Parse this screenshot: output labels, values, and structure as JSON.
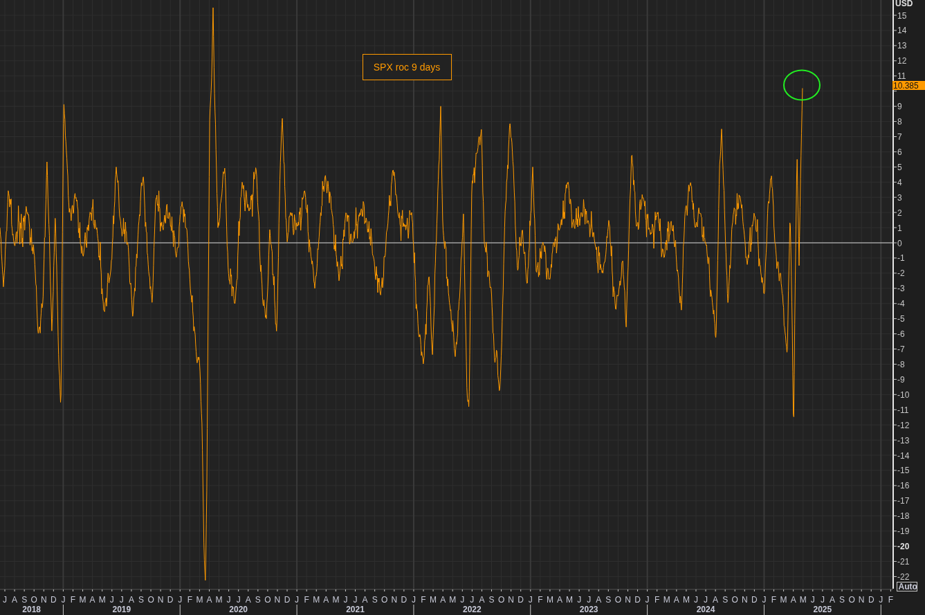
{
  "chart": {
    "legend": "SPX roc 9 days",
    "currency": "USD",
    "last_value": "10.385",
    "auto_button": "Auto",
    "y_labels_upper": [
      {
        "label": "15",
        "bold": false
      },
      {
        "label": "14",
        "bold": false
      },
      {
        "label": "13",
        "bold": false
      },
      {
        "label": "12",
        "bold": false
      },
      {
        "label": "11",
        "bold": false
      }
    ],
    "y_labels_lower": [
      {
        "label": "9",
        "bold": false
      },
      {
        "label": "8",
        "bold": false
      },
      {
        "label": "7",
        "bold": false
      },
      {
        "label": "6",
        "bold": false
      },
      {
        "label": "5",
        "bold": false
      },
      {
        "label": "4",
        "bold": false
      },
      {
        "label": "3",
        "bold": false
      },
      {
        "label": "2",
        "bold": false
      },
      {
        "label": "1",
        "bold": false
      },
      {
        "label": "0",
        "bold": false
      },
      {
        "label": "-1",
        "bold": false
      },
      {
        "label": "-2",
        "bold": false
      },
      {
        "label": "-3",
        "bold": false
      },
      {
        "label": "-4",
        "bold": false
      },
      {
        "label": "-5",
        "bold": false
      },
      {
        "label": "-6",
        "bold": false
      },
      {
        "label": "-7",
        "bold": false
      },
      {
        "label": "-8",
        "bold": false
      },
      {
        "label": "-9",
        "bold": false
      },
      {
        "label": "-10",
        "bold": false
      },
      {
        "label": "-11",
        "bold": false
      },
      {
        "label": "-12",
        "bold": false
      },
      {
        "label": "-13",
        "bold": false
      },
      {
        "label": "-14",
        "bold": false
      },
      {
        "label": "-15",
        "bold": false
      },
      {
        "label": "-16",
        "bold": false
      },
      {
        "label": "-17",
        "bold": false
      },
      {
        "label": "-18",
        "bold": false
      },
      {
        "label": "-19",
        "bold": false
      },
      {
        "label": "-20",
        "bold": true
      },
      {
        "label": "-21",
        "bold": false
      },
      {
        "label": "-22",
        "bold": false
      }
    ],
    "years": [
      {
        "label": "2018",
        "months": [
          "J",
          "A",
          "S",
          "O",
          "N",
          "D"
        ]
      },
      {
        "label": "2019",
        "months": [
          "J",
          "F",
          "M",
          "A",
          "M",
          "J",
          "J",
          "A",
          "S",
          "O",
          "N",
          "D"
        ]
      },
      {
        "label": "2020",
        "months": [
          "J",
          "F",
          "M",
          "A",
          "M",
          "J",
          "J",
          "A",
          "S",
          "O",
          "N",
          "D"
        ]
      },
      {
        "label": "2021",
        "months": [
          "J",
          "F",
          "M",
          "A",
          "M",
          "J",
          "J",
          "A",
          "S",
          "O",
          "N",
          "D"
        ]
      },
      {
        "label": "2022",
        "months": [
          "J",
          "F",
          "M",
          "A",
          "M",
          "J",
          "J",
          "A",
          "S",
          "O",
          "N",
          "D"
        ]
      },
      {
        "label": "2023",
        "months": [
          "J",
          "F",
          "M",
          "A",
          "M",
          "J",
          "J",
          "A",
          "S",
          "O",
          "N",
          "D"
        ]
      },
      {
        "label": "2024",
        "months": [
          "J",
          "F",
          "M",
          "A",
          "M",
          "J",
          "J",
          "A",
          "S",
          "O",
          "N",
          "D"
        ]
      },
      {
        "label": "2025",
        "months": [
          "J",
          "F",
          "M",
          "A",
          "M",
          "J",
          "J",
          "A",
          "S",
          "O",
          "N",
          "D"
        ]
      }
    ],
    "trailing_months": [
      "J",
      "F"
    ]
  }
}
